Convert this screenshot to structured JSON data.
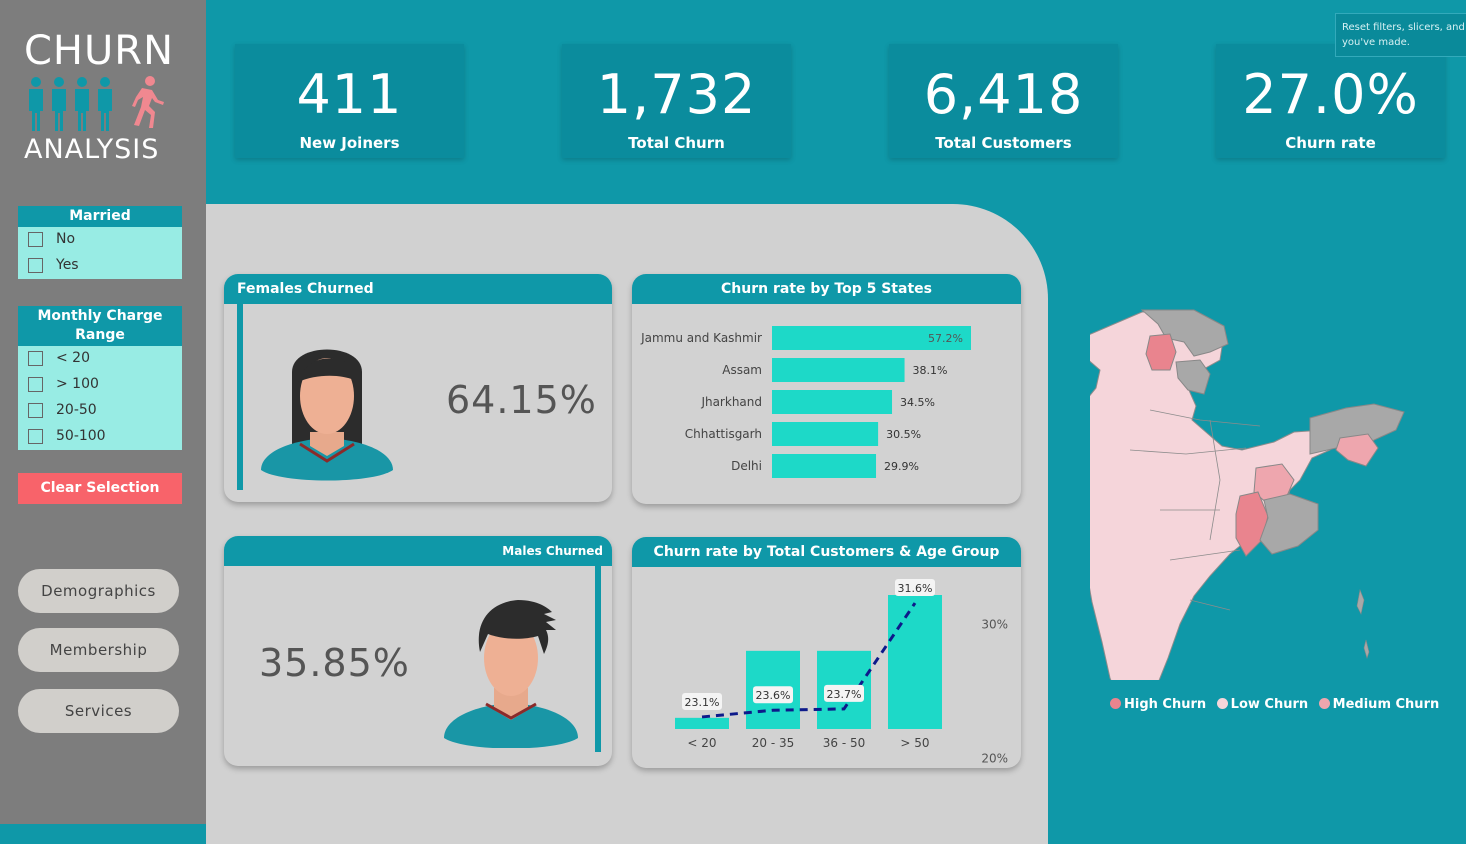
{
  "logo": {
    "line1": "CHURN",
    "line2": "ANALYSIS"
  },
  "kpis": [
    {
      "value": "411",
      "label": "New Joiners"
    },
    {
      "value": "1,732",
      "label": "Total Churn"
    },
    {
      "value": "6,418",
      "label": "Total Customers"
    },
    {
      "value": "27.0%",
      "label": "Churn rate"
    }
  ],
  "tooltip": {
    "line1": "Reset filters, slicers, and ot",
    "line2": "you've made."
  },
  "slicers": {
    "married": {
      "title": "Married",
      "options": [
        "No",
        "Yes"
      ]
    },
    "monthly_charge": {
      "title_line1": "Monthly Charge",
      "title_line2": "Range",
      "options": [
        "< 20",
        "> 100",
        "20-50",
        "50-100"
      ]
    }
  },
  "clear_button": "Clear Selection",
  "nav": [
    "Demographics",
    "Membership",
    "Services"
  ],
  "females": {
    "title": "Females Churned",
    "value": "64.15%"
  },
  "males": {
    "title": "Males Churned",
    "value": "35.85%"
  },
  "states_chart_title": "Churn rate by Top 5 States",
  "age_chart_title": "Churn rate by Total Customers & Age Group",
  "map_legend": [
    {
      "label": "High Churn",
      "color": "#e9848e"
    },
    {
      "label": "Low Churn",
      "color": "#f5d5da"
    },
    {
      "label": "Medium Churn",
      "color": "#eea6ae"
    }
  ],
  "colors": {
    "teal": "#0f98a8",
    "bar": "#1dd9c8",
    "accent": "#f8636a",
    "line": "#0d1a8a"
  },
  "chart_data": [
    {
      "type": "bar",
      "orientation": "horizontal",
      "title": "Churn rate by Top 5 States",
      "categories": [
        "Jammu and Kashmir",
        "Assam",
        "Jharkhand",
        "Chhattisgarh",
        "Delhi"
      ],
      "values": [
        57.2,
        38.1,
        34.5,
        30.5,
        29.9
      ],
      "value_labels": [
        "57.2%",
        "38.1%",
        "34.5%",
        "30.5%",
        "29.9%"
      ],
      "xlim": [
        0,
        57.2
      ]
    },
    {
      "type": "bar",
      "title": "Churn rate by Total Customers & Age Group",
      "categories": [
        "< 20",
        "20 - 35",
        "36 - 50",
        "> 50"
      ],
      "series": [
        {
          "values": [
            0.3,
            2.1,
            2.1,
            3.6
          ]
        },
        {
          "type": "line",
          "values": [
            23.1,
            23.6,
            23.7,
            31.6
          ],
          "labels": [
            "23.1%",
            "23.6%",
            "23.7%",
            "31.6%"
          ]
        }
      ],
      "y2_ticks": [
        "30%",
        "20%"
      ],
      "y2lim": [
        22.2,
        32.2
      ]
    }
  ]
}
